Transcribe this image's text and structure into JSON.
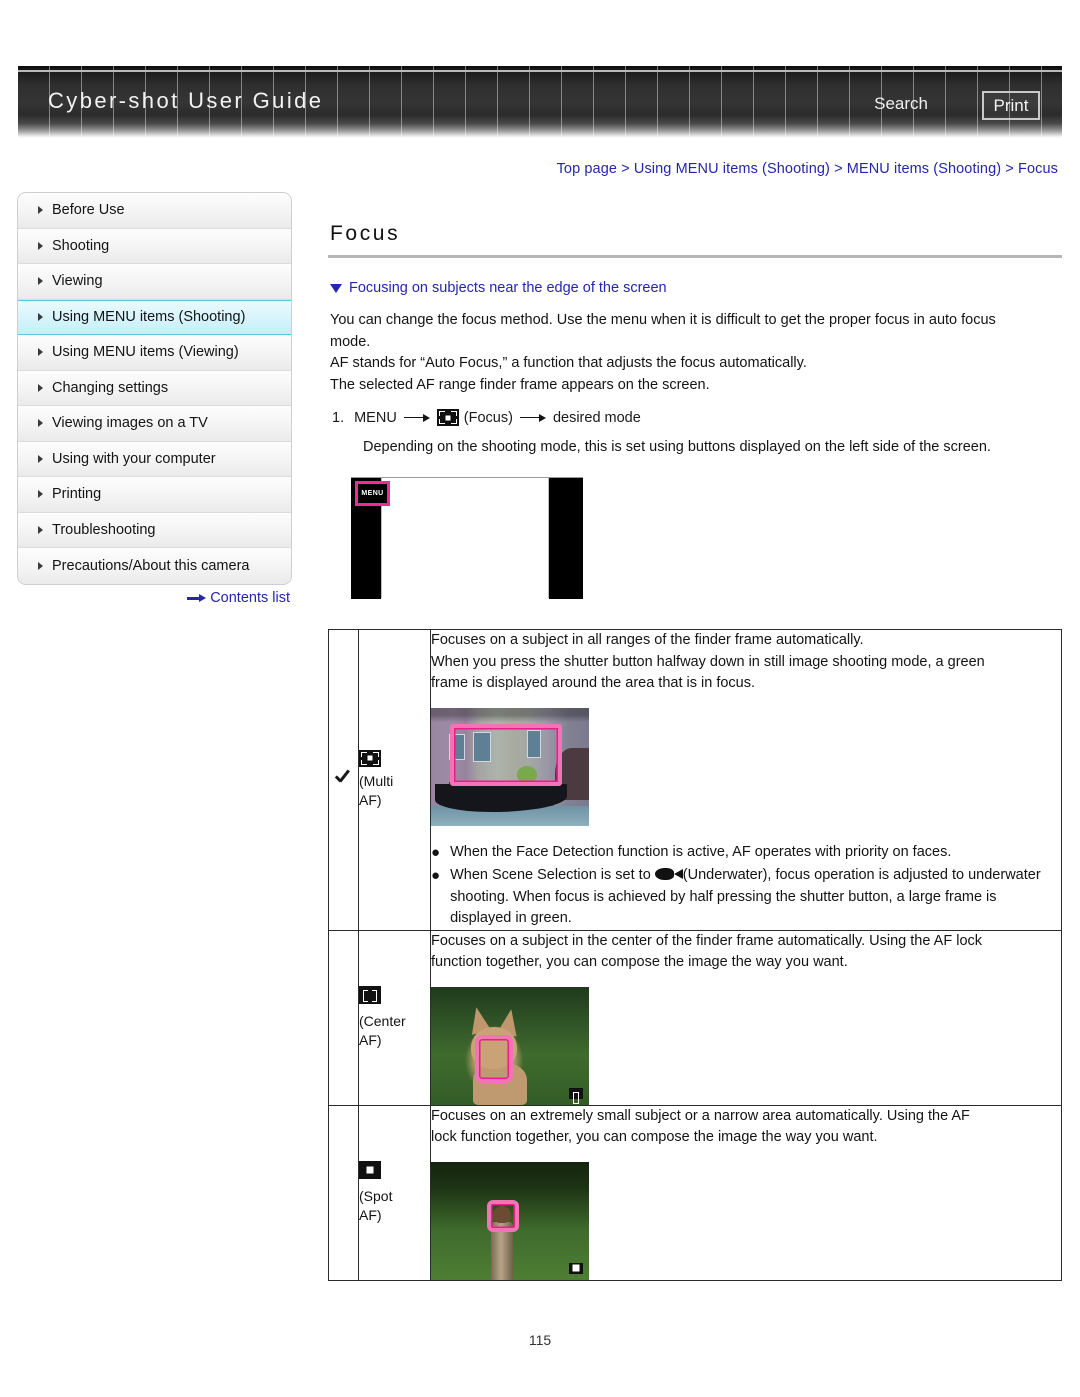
{
  "header": {
    "site_title": "Cyber-shot User Guide",
    "search_label": "Search",
    "print_label": "Print"
  },
  "breadcrumb": "Top page > Using MENU items (Shooting) > MENU items (Shooting) > Focus",
  "sidebar": {
    "items": [
      {
        "label": "Before Use",
        "active": false
      },
      {
        "label": "Shooting",
        "active": false
      },
      {
        "label": "Viewing",
        "active": false
      },
      {
        "label": "Using MENU items (Shooting)",
        "active": true
      },
      {
        "label": "Using MENU items (Viewing)",
        "active": false
      },
      {
        "label": "Changing settings",
        "active": false
      },
      {
        "label": "Viewing images on a TV",
        "active": false
      },
      {
        "label": "Using with your computer",
        "active": false
      },
      {
        "label": "Printing",
        "active": false
      },
      {
        "label": "Troubleshooting",
        "active": false
      },
      {
        "label": "Precautions/About this camera",
        "active": false
      }
    ],
    "contents_list_label": "Contents list"
  },
  "main": {
    "title": "Focus",
    "anchor_link": "Focusing on subjects near the edge of the screen",
    "intro_line1": "You can change the focus method. Use the menu when it is difficult to get the proper focus in auto focus",
    "intro_line2": "mode.",
    "intro_line3": "AF stands for “Auto Focus,” a function that adjusts the focus automatically.",
    "intro_line4": "The selected AF range finder frame appears on the screen.",
    "step_number": "1.",
    "step_menu": "MENU",
    "step_focus_label": "(Focus)",
    "step_desired_mode": "desired mode",
    "step_note": "Depending on the shooting mode, this is set using buttons displayed on the left side of the screen.",
    "screen_menu_button": "MENU"
  },
  "table": {
    "rows": [
      {
        "checked": true,
        "mode_label_line1": "(Multi",
        "mode_label_line2": "AF)",
        "icon": "multi-af-icon",
        "desc_line1": "Focuses on a subject in all ranges of the finder frame automatically.",
        "desc_line2": "When you press the shutter button halfway down in still image shooting mode, a green",
        "desc_line3": "frame is displayed around the area that is in focus.",
        "bullets": [
          {
            "text_before": "When the Face Detection function is active, AF operates with priority on faces.",
            "icon": null,
            "text_after": ""
          },
          {
            "text_before": "When Scene Selection is set to ",
            "icon": "fish-icon",
            "text_after": "(Underwater), focus operation is adjusted to underwater shooting. When focus is achieved by half pressing the shutter button, a large frame is displayed in green."
          }
        ]
      },
      {
        "checked": false,
        "mode_label_line1": "(Center",
        "mode_label_line2": "AF)",
        "icon": "center-af-icon",
        "desc_line1": "Focuses on a subject in the center of the finder frame automatically. Using the AF lock",
        "desc_line2": "function together, you can compose the image the way you want.",
        "desc_line3": "",
        "bullets": []
      },
      {
        "checked": false,
        "mode_label_line1": "(Spot",
        "mode_label_line2": "AF)",
        "icon": "spot-af-icon",
        "desc_line1": "Focuses on an extremely small subject or a narrow area automatically. Using the AF",
        "desc_line2": "lock function together, you can compose the image the way you want.",
        "desc_line3": "",
        "bullets": []
      }
    ]
  },
  "page_number": "115",
  "colors": {
    "link_blue": "#2525b0",
    "af_frame_pink": "#f472b6",
    "active_nav_cyan": "#c6eef8"
  }
}
